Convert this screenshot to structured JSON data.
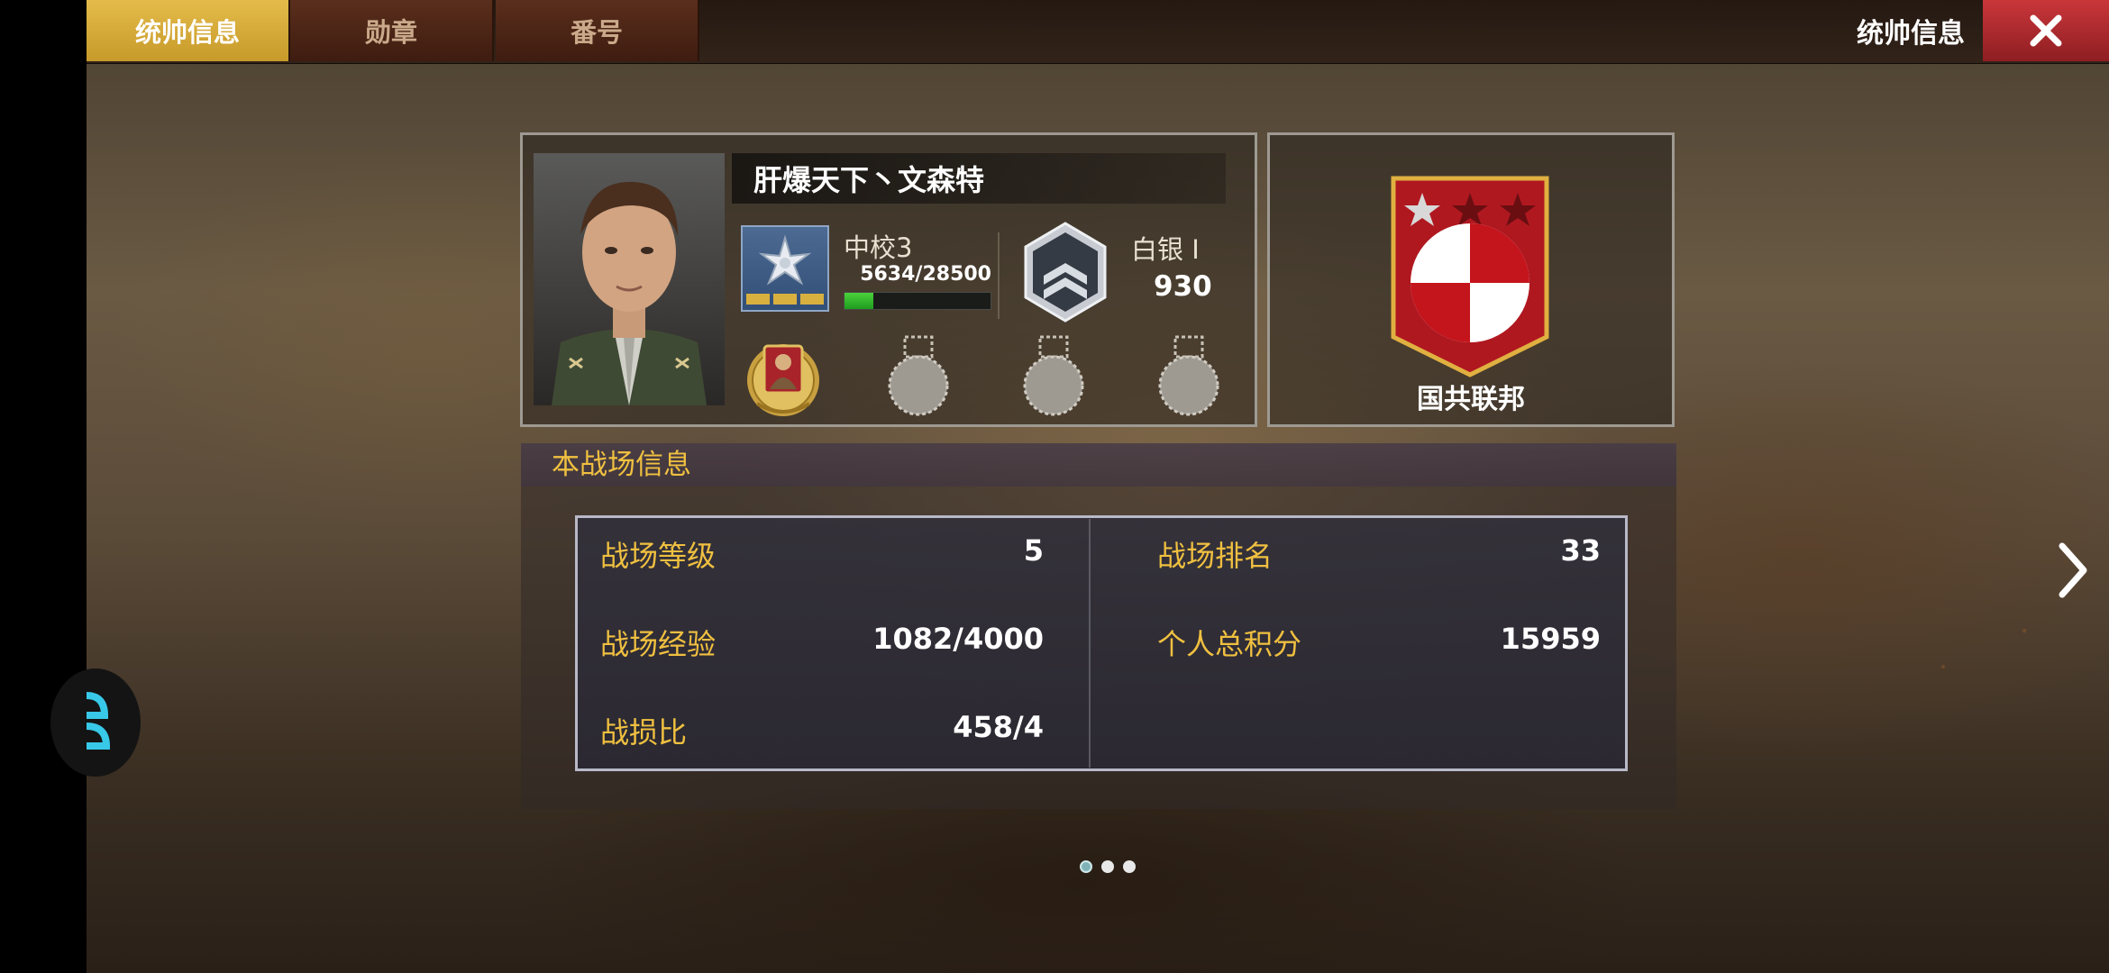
{
  "tabs": [
    {
      "label": "统帅信息",
      "active": true
    },
    {
      "label": "勋章",
      "active": false
    },
    {
      "label": "番号",
      "active": false
    }
  ],
  "header": {
    "title": "统帅信息",
    "close_icon": "close-icon"
  },
  "profile": {
    "name": "肝爆天下丶文森特",
    "rank": {
      "name": "中校3",
      "exp_text": "5634/28500",
      "exp_current": 5634,
      "exp_max": 28500
    },
    "tier": {
      "name": "白银 I",
      "score": "930"
    },
    "medals": [
      "soldier-medal-icon",
      "empty-medal-slot-icon",
      "empty-medal-slot-icon",
      "empty-medal-slot-icon"
    ]
  },
  "faction": {
    "name": "国共联邦",
    "stars_filled": 1,
    "stars_total": 3
  },
  "battlefield": {
    "title": "本战场信息",
    "left": [
      {
        "label": "战场等级",
        "value": "5"
      },
      {
        "label": "战场经验",
        "value": "1082/4000"
      },
      {
        "label": "战损比",
        "value": "458/4"
      }
    ],
    "right": [
      {
        "label": "战场排名",
        "value": "33"
      },
      {
        "label": "个人总积分",
        "value": "15959"
      }
    ]
  },
  "pager": {
    "pages": 3,
    "current": 1
  },
  "colors": {
    "accent_gold": "#f0c040",
    "tab_active": "#d4a83a",
    "close_red": "#b02a2e",
    "exp_green": "#3ac23a"
  }
}
